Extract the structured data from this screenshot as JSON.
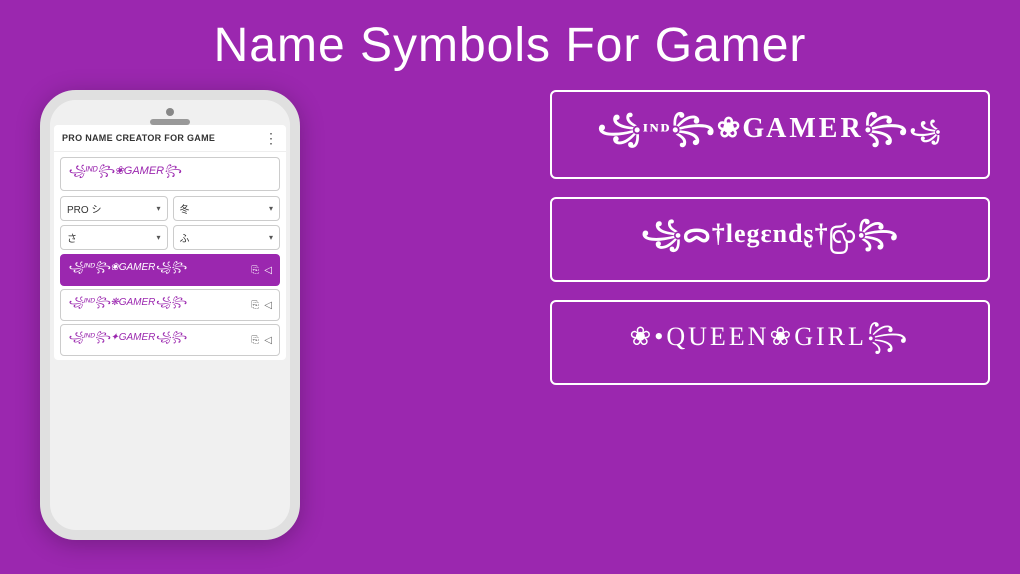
{
  "header": {
    "title": "Name Symbols For Gamer"
  },
  "phone": {
    "screen_title": "PRO NAME CREATOR FOR GAME",
    "input_value": "꧁ᴵᴺᴰ꧂❀GAMER꧂",
    "dropdowns_row1": [
      {
        "label": "PRO シ",
        "arrow": "▾"
      },
      {
        "label": "冬",
        "arrow": "▾"
      }
    ],
    "dropdowns_row2": [
      {
        "label": "さ",
        "arrow": "▾"
      },
      {
        "label": "ふ",
        "arrow": "▾"
      }
    ],
    "results": [
      {
        "text": "꧁ᴵᴺᴰ꧂❀GAMER꧁꧂",
        "copy": "⎘",
        "share": "◁"
      },
      {
        "text": "꧁ᴵᴺᴰ꧂❋GAMER꧁꧂",
        "copy": "⎘",
        "share": "◁"
      },
      {
        "text": "꧁ᴵᴺᴰ꧂✦GAMER꧁꧂",
        "copy": "⎘",
        "share": "◁"
      }
    ]
  },
  "gamer_boxes": [
    {
      "id": "box1",
      "content": "꧁ᴵᴺᴰ꧂❀GAMER꧂꧁"
    },
    {
      "id": "box2",
      "content": "꧁ᯅ†legєndƨ†ꩺ꧂"
    },
    {
      "id": "box3",
      "content": "❀•QUEEN❀GIRL꧂꧁"
    }
  ]
}
